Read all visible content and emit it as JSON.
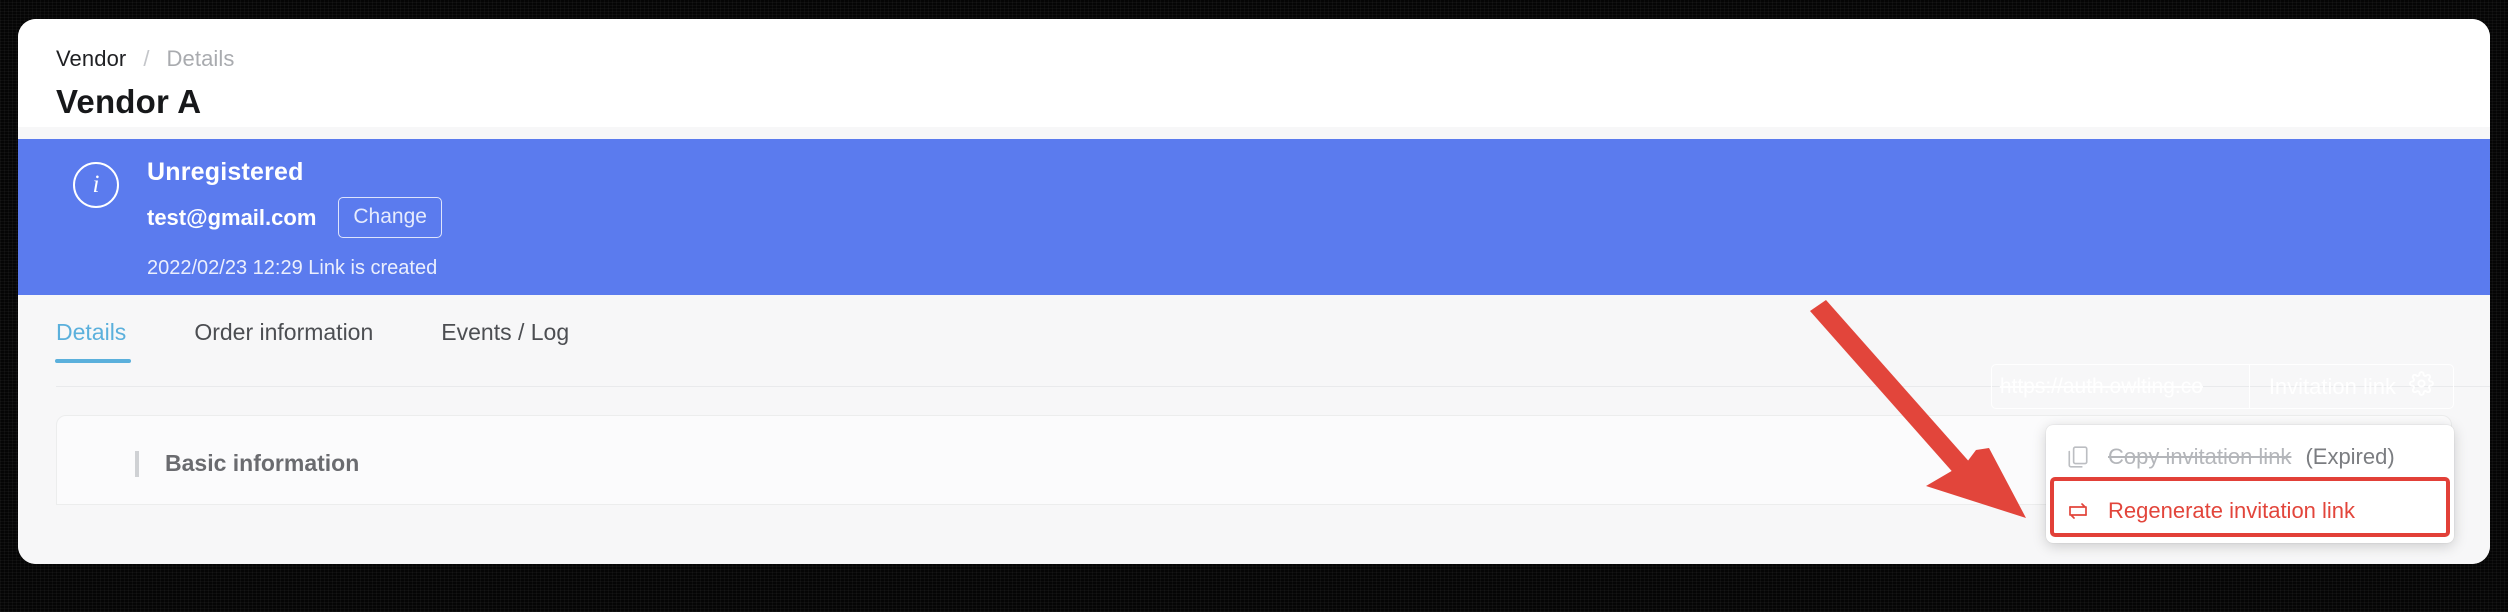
{
  "breadcrumb": {
    "root": "Vendor",
    "separator": "/",
    "leaf": "Details"
  },
  "page_title": "Vendor A",
  "banner": {
    "icon": "info-circle-icon",
    "status": "Unregistered",
    "email": "test@gmail.com",
    "change_label": "Change",
    "meta": "2022/02/23 12:29 Link is created",
    "link_value": "https://auth.owlting.co",
    "invitation_button_label": "Invitation link",
    "invitation_button_icon": "gear-icon",
    "background_color": "#5b7bee"
  },
  "dropdown": {
    "items": [
      {
        "icon": "copy-icon",
        "label": "Copy invitation link",
        "note": "(Expired)",
        "state": "disabled"
      },
      {
        "icon": "regenerate-icon",
        "label": "Regenerate invitation link",
        "note": "",
        "state": "danger"
      }
    ]
  },
  "annotation": {
    "highlight_color": "#e24038",
    "arrow_color": "#e2453b",
    "target": "Regenerate invitation link"
  },
  "tabs": [
    {
      "label": "Details",
      "active": true
    },
    {
      "label": "Order information",
      "active": false
    },
    {
      "label": "Events / Log",
      "active": false
    }
  ],
  "tab_accent_color": "#5bb0dc",
  "content_card": {
    "heading": "Basic information"
  }
}
